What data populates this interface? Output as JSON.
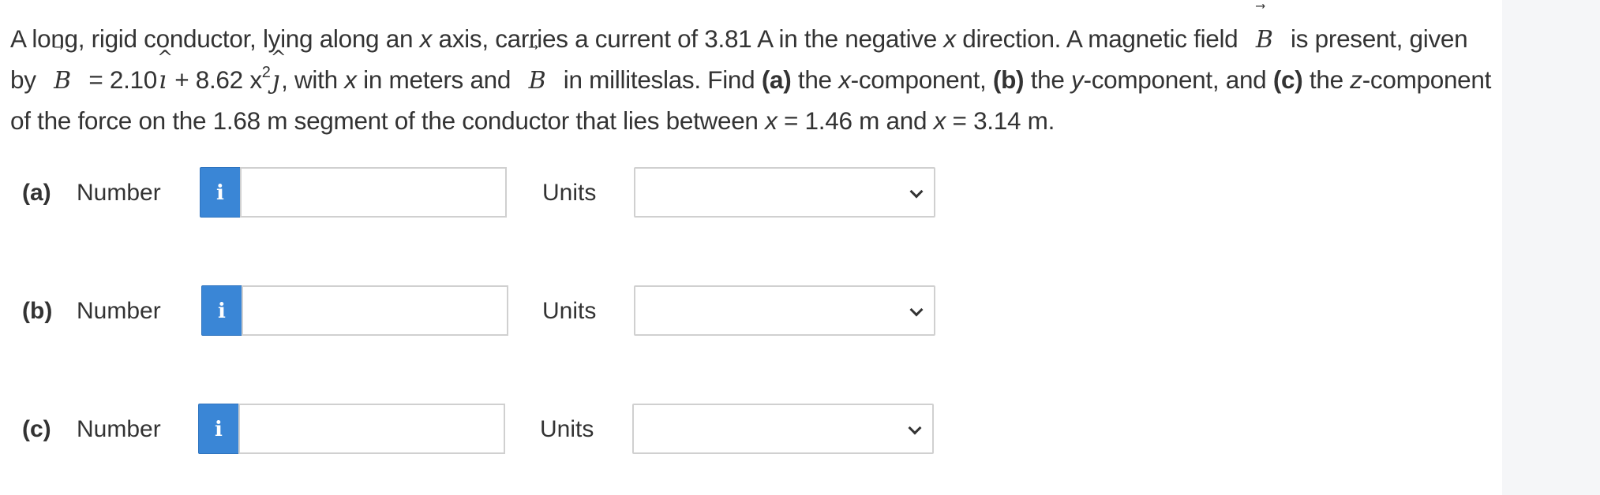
{
  "question": {
    "s1": "A long, rigid conductor, lying along an ",
    "var_x1": "x",
    "s2": " axis, carries a current of 3.81 A in the negative ",
    "var_x2": "x",
    "s3": " direction. A magnetic field ",
    "vec_B": "B",
    "arrow": "⃗",
    "s4": " is present, given by ",
    "s5": " = 2.10",
    "i_hat": "ı",
    "s6": " + 8.62 ",
    "var_x3": "x",
    "sup2": "2",
    "j_hat": "ȷ",
    "s7": ", with ",
    "var_x4": "x",
    "s8": " in meters and ",
    "s9": " in milliteslas. Find ",
    "a": "(a)",
    "s10": " the ",
    "var_x5": "x",
    "s11": "-component, ",
    "b": "(b)",
    "s12": " the ",
    "var_y": "y",
    "s13": "-component, and ",
    "c": "(c)",
    "s14": " the ",
    "var_z": "z",
    "s15": "-component of the force on the 1.68 m segment of the conductor that lies between ",
    "var_x6": "x",
    "s16": " = 1.46 m and ",
    "var_x7": "x",
    "s17": " = 3.14 m.",
    "hat": "^"
  },
  "parts": [
    {
      "label": "(a)",
      "number_label": "Number",
      "info": "i",
      "value": "",
      "units_label": "Units",
      "units_value": ""
    },
    {
      "label": "(b)",
      "number_label": "Number",
      "info": "i",
      "value": "",
      "units_label": "Units",
      "units_value": ""
    },
    {
      "label": "(c)",
      "number_label": "Number",
      "info": "i",
      "value": "",
      "units_label": "Units",
      "units_value": ""
    }
  ],
  "colors": {
    "info_button": "#3a86d6",
    "input_border": "#d0d0d0",
    "side_strip": "#f5f6f8"
  }
}
